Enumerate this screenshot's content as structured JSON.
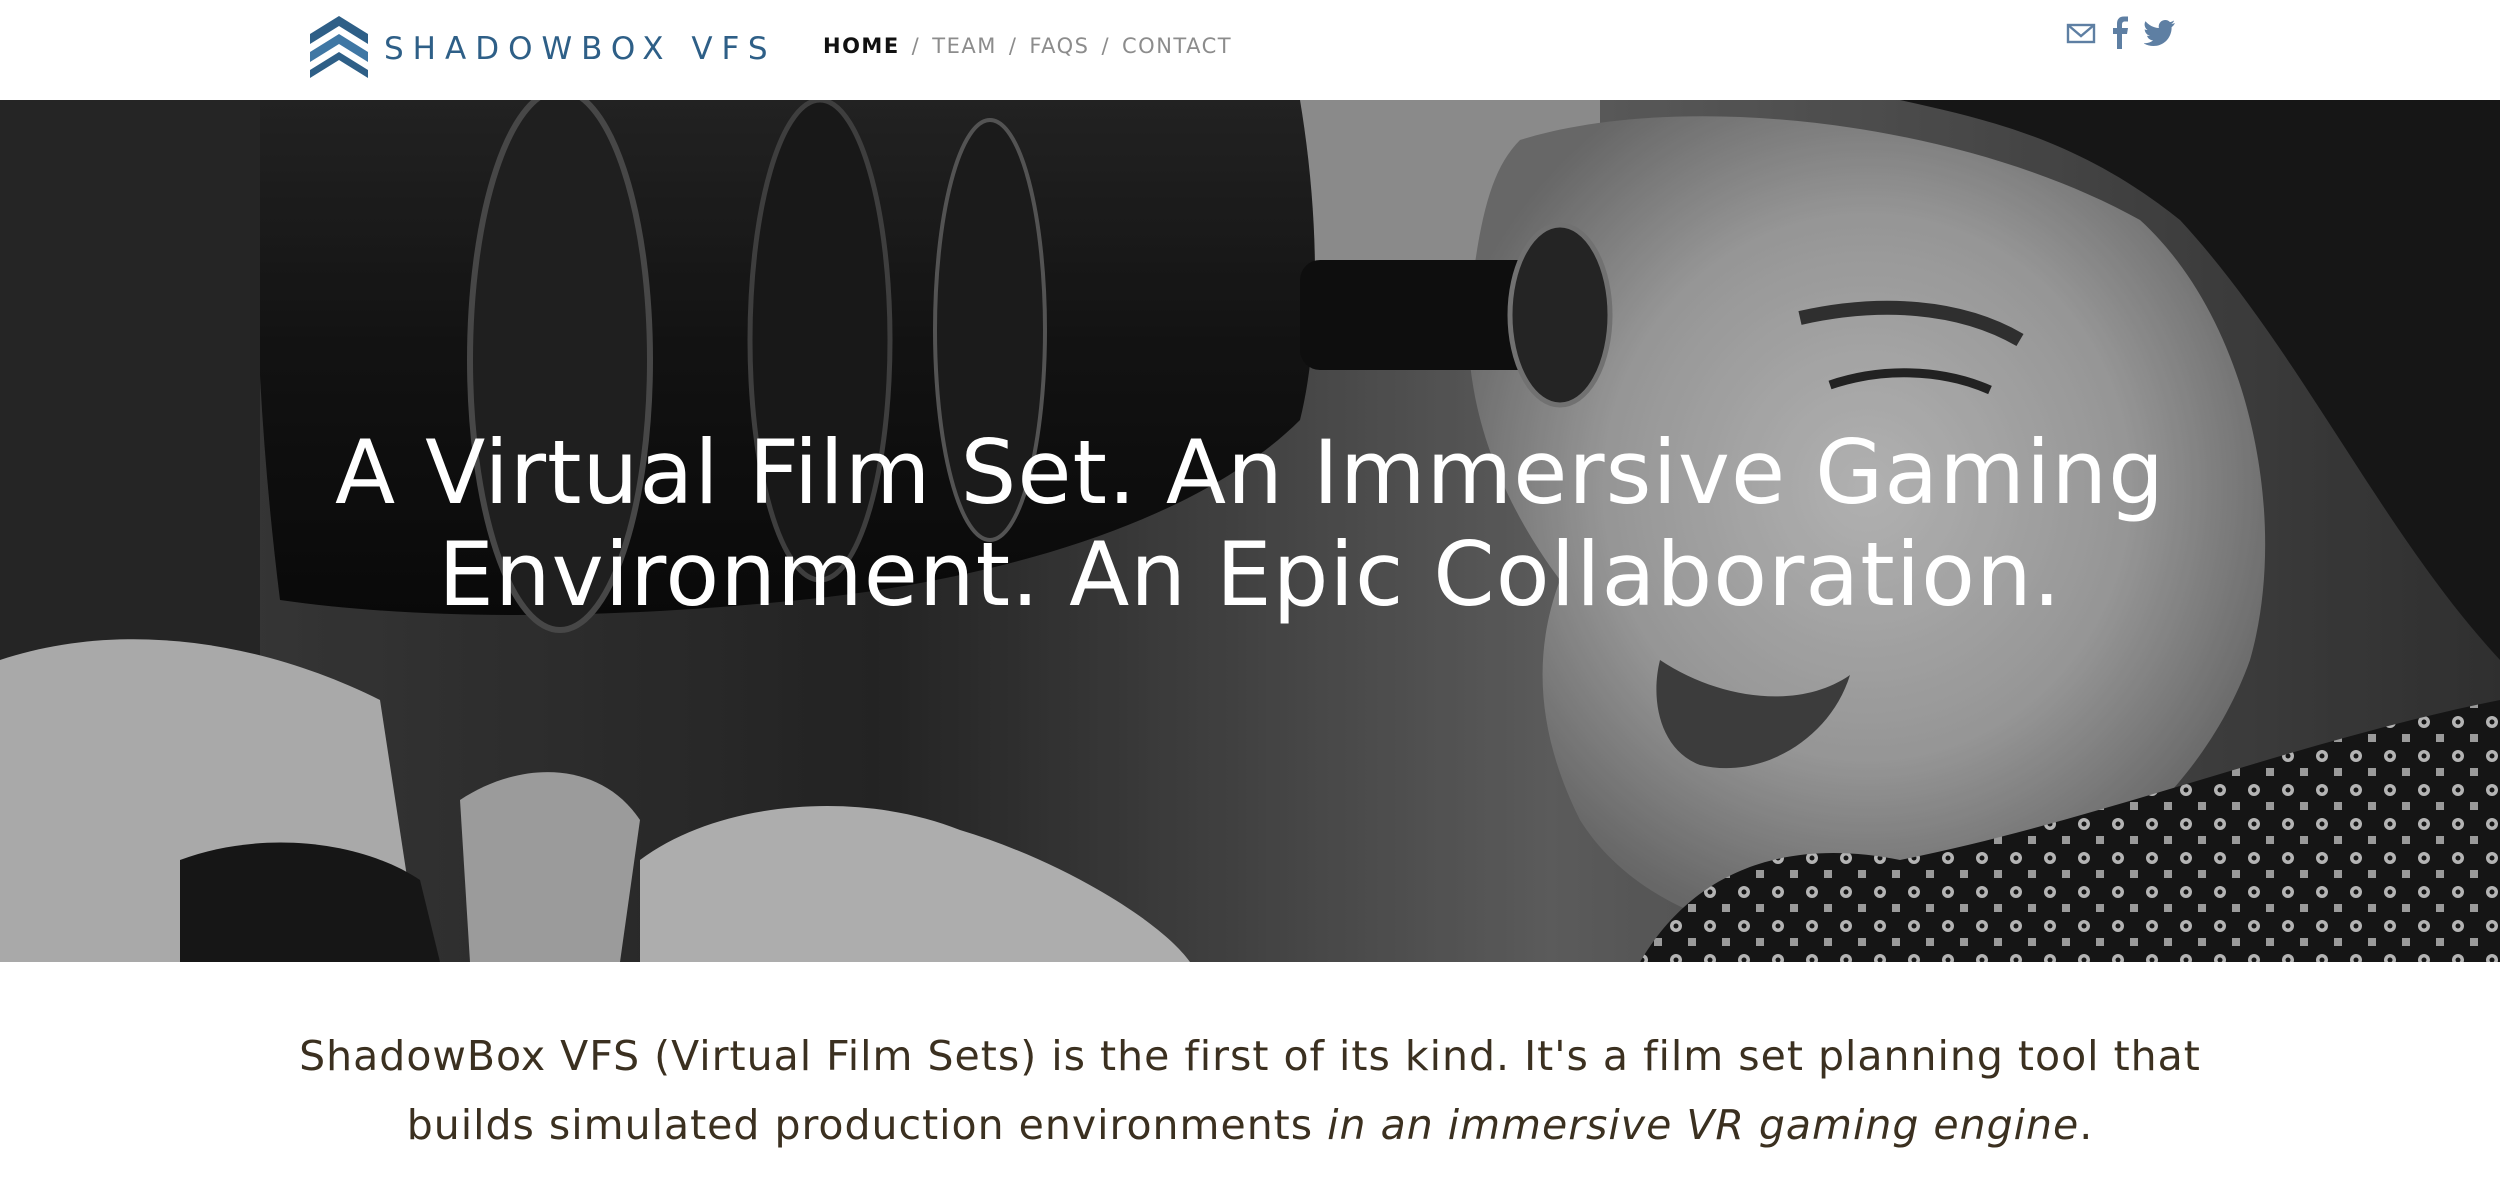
{
  "brand": {
    "name": "SHADOWBOX VFS",
    "logo_icon": "chevron-stack-logo-icon",
    "accent_color": "#2e5f87"
  },
  "nav": {
    "items": [
      {
        "label": "HOME",
        "active": true
      },
      {
        "label": "TEAM",
        "active": false
      },
      {
        "label": "FAQS",
        "active": false
      },
      {
        "label": "CONTACT",
        "active": false
      }
    ],
    "separator": "/"
  },
  "social": {
    "icons": [
      "mail-icon",
      "facebook-icon",
      "twitter-icon"
    ],
    "icon_color": "#5e7fa3"
  },
  "hero": {
    "headline": "A Virtual Film Set. An Immersive Gaming Environment. An Epic Collaboration.",
    "image_description_icon": "vintage-camera-operator-photo"
  },
  "intro": {
    "text_plain": "ShadowBox VFS (Virtual Film Sets) is the first of its kind. It's a film set planning tool that builds simulated production environments ",
    "text_emphasis": "in an immersive VR gaming engine",
    "text_end": ".",
    "text_color": "#3b3020"
  }
}
